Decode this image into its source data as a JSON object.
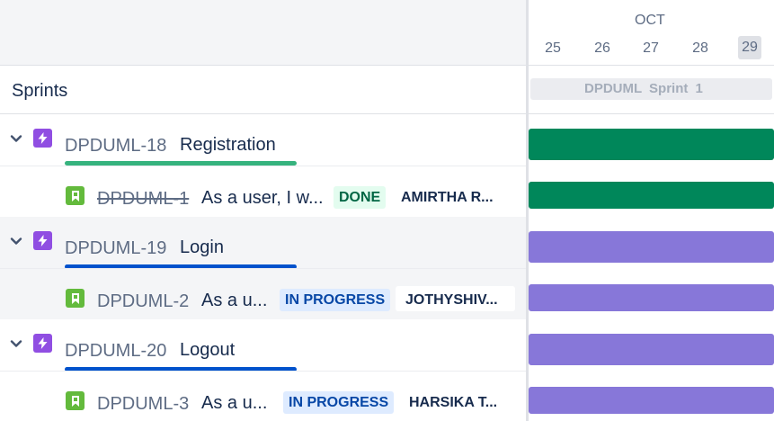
{
  "timeline": {
    "month": "OCT",
    "days": [
      "25",
      "26",
      "27",
      "28",
      "29"
    ],
    "today": "29",
    "sprint_name": "DPDUML Sprint 1"
  },
  "sidebar": {
    "sprints_label": "Sprints"
  },
  "epics": [
    {
      "key": "DPDUML-18",
      "title": "Registration",
      "progress_color": "#36b37e",
      "bar_color": "#00875a",
      "story": {
        "key": "DPDUML-1",
        "title": "As a user, I w...",
        "status": "DONE",
        "assignee": "AMIRTHA R...",
        "done": true
      }
    },
    {
      "key": "DPDUML-19",
      "title": "Login",
      "progress_color": "#0052cc",
      "bar_color": "#8777d9",
      "story": {
        "key": "DPDUML-2",
        "title": "As a u...",
        "status": "IN PROGRESS",
        "assignee": "JOTHYSHIV...",
        "done": false
      }
    },
    {
      "key": "DPDUML-20",
      "title": "Logout",
      "progress_color": "#0052cc",
      "bar_color": "#8777d9",
      "story": {
        "key": "DPDUML-3",
        "title": "As a u...",
        "status": "IN PROGRESS",
        "assignee": "HARSIKA T...",
        "done": false
      }
    }
  ],
  "icons": {
    "chevron": "chevron-down-icon",
    "epic": "lightning-bolt-icon",
    "story": "bookmark-icon"
  },
  "colors": {
    "epic_icon": "#904ee2",
    "story_icon": "#63ba3c",
    "done_bar": "#00875a",
    "in_progress_bar": "#8777d9"
  }
}
